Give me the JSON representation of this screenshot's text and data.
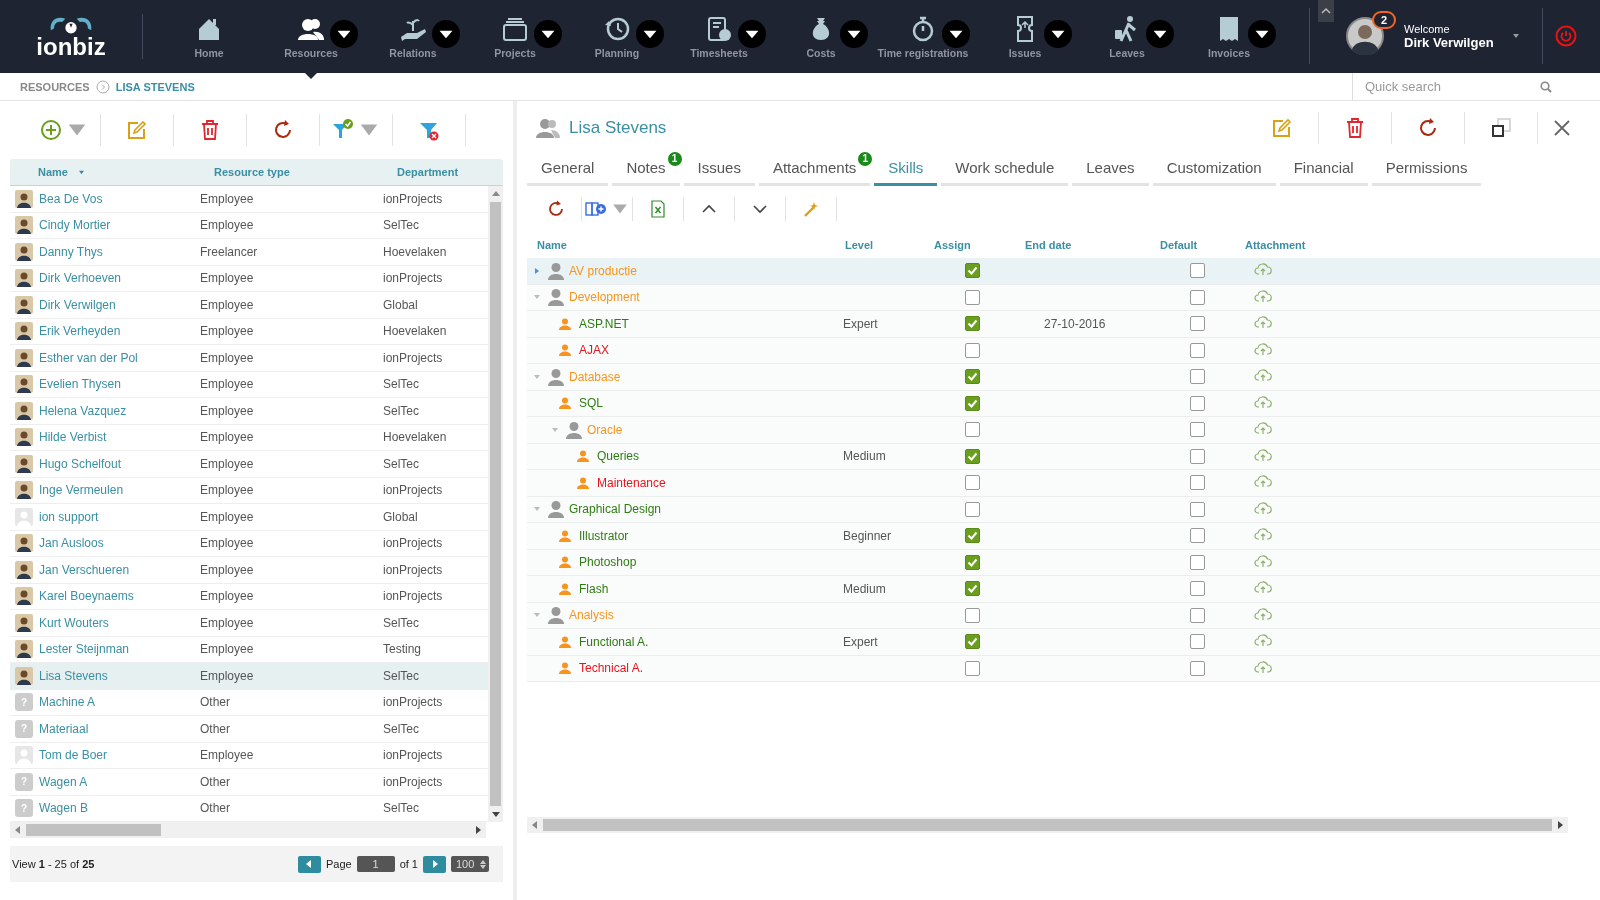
{
  "brand": "ionbiz",
  "nav": [
    {
      "label": "Home",
      "menu": false,
      "selected": false
    },
    {
      "label": "Resources",
      "menu": true,
      "selected": true
    },
    {
      "label": "Relations",
      "menu": true,
      "selected": false
    },
    {
      "label": "Projects",
      "menu": true,
      "selected": false
    },
    {
      "label": "Planning",
      "menu": true,
      "selected": false
    },
    {
      "label": "Timesheets",
      "menu": true,
      "selected": false
    },
    {
      "label": "Costs",
      "menu": true,
      "selected": false
    },
    {
      "label": "Time registrations",
      "menu": true,
      "selected": false
    },
    {
      "label": "Issues",
      "menu": true,
      "selected": false
    },
    {
      "label": "Leaves",
      "menu": true,
      "selected": false
    },
    {
      "label": "Invoices",
      "menu": true,
      "selected": false
    }
  ],
  "user": {
    "greeting": "Welcome",
    "name": "Dirk Verwilgen",
    "notifications": "2"
  },
  "breadcrumb": [
    "RESOURCES",
    "LISA STEVENS"
  ],
  "search": {
    "placeholder": "Quick search"
  },
  "resources": {
    "columns": [
      "Name",
      "Resource type",
      "Department"
    ],
    "rows": [
      {
        "name": "Bea De Vos",
        "type": "Employee",
        "department": "ionProjects",
        "kind": "photo",
        "selected": false
      },
      {
        "name": "Cindy Mortier",
        "type": "Employee",
        "department": "SelTec",
        "kind": "photo",
        "selected": false
      },
      {
        "name": "Danny Thys",
        "type": "Freelancer",
        "department": "Hoevelaken",
        "kind": "photo",
        "selected": false
      },
      {
        "name": "Dirk Verhoeven",
        "type": "Employee",
        "department": "ionProjects",
        "kind": "photo",
        "selected": false
      },
      {
        "name": "Dirk Verwilgen",
        "type": "Employee",
        "department": "Global",
        "kind": "photo",
        "selected": false
      },
      {
        "name": "Erik Verheyden",
        "type": "Employee",
        "department": "Hoevelaken",
        "kind": "photo",
        "selected": false
      },
      {
        "name": "Esther van der Pol",
        "type": "Employee",
        "department": "ionProjects",
        "kind": "photo",
        "selected": false
      },
      {
        "name": "Evelien Thysen",
        "type": "Employee",
        "department": "SelTec",
        "kind": "photo",
        "selected": false
      },
      {
        "name": "Helena Vazquez",
        "type": "Employee",
        "department": "SelTec",
        "kind": "photo",
        "selected": false
      },
      {
        "name": "Hilde Verbist",
        "type": "Employee",
        "department": "Hoevelaken",
        "kind": "photo",
        "selected": false
      },
      {
        "name": "Hugo Schelfout",
        "type": "Employee",
        "department": "SelTec",
        "kind": "photo",
        "selected": false
      },
      {
        "name": "Inge Vermeulen",
        "type": "Employee",
        "department": "ionProjects",
        "kind": "photo",
        "selected": false
      },
      {
        "name": "ion support",
        "type": "Employee",
        "department": "Global",
        "kind": "silhouette",
        "selected": false
      },
      {
        "name": "Jan Ausloos",
        "type": "Employee",
        "department": "ionProjects",
        "kind": "photo",
        "selected": false
      },
      {
        "name": "Jan Verschueren",
        "type": "Employee",
        "department": "ionProjects",
        "kind": "photo",
        "selected": false
      },
      {
        "name": "Karel Boeynaems",
        "type": "Employee",
        "department": "ionProjects",
        "kind": "photo",
        "selected": false
      },
      {
        "name": "Kurt Wouters",
        "type": "Employee",
        "department": "SelTec",
        "kind": "photo",
        "selected": false
      },
      {
        "name": "Lester Steijnman",
        "type": "Employee",
        "department": "Testing",
        "kind": "photo",
        "selected": false
      },
      {
        "name": "Lisa Stevens",
        "type": "Employee",
        "department": "SelTec",
        "kind": "photo",
        "selected": true
      },
      {
        "name": "Machine A",
        "type": "Other",
        "department": "ionProjects",
        "kind": "unknown",
        "avatar_text": "?",
        "selected": false
      },
      {
        "name": "Materiaal",
        "type": "Other",
        "department": "SelTec",
        "kind": "unknown",
        "avatar_text": "?",
        "selected": false
      },
      {
        "name": "Tom de Boer",
        "type": "Employee",
        "department": "ionProjects",
        "kind": "silhouette",
        "selected": false
      },
      {
        "name": "Wagen A",
        "type": "Other",
        "department": "ionProjects",
        "kind": "unknown",
        "avatar_text": "?",
        "selected": false
      },
      {
        "name": "Wagen B",
        "type": "Other",
        "department": "SelTec",
        "kind": "unknown",
        "avatar_text": "?",
        "selected": false
      }
    ],
    "pager": {
      "summary": "View **1** - 25 of **25**",
      "page_label": "Page",
      "page": "1",
      "of": "of 1",
      "page_size": "100"
    }
  },
  "detail": {
    "title": "Lisa Stevens",
    "tabs": [
      {
        "label": "General",
        "selected": false
      },
      {
        "label": "Notes",
        "badge": "1",
        "selected": false
      },
      {
        "label": "Issues",
        "selected": false
      },
      {
        "label": "Attachments",
        "badge": "1",
        "selected": false
      },
      {
        "label": "Skills",
        "selected": true
      },
      {
        "label": "Work schedule",
        "selected": false
      },
      {
        "label": "Leaves",
        "selected": false
      },
      {
        "label": "Customization",
        "selected": false
      },
      {
        "label": "Financial",
        "selected": false
      },
      {
        "label": "Permissions",
        "selected": false
      }
    ],
    "skills": {
      "columns": [
        "Name",
        "Level",
        "Assign",
        "End date",
        "Default",
        "Attachment"
      ],
      "rows": [
        {
          "kind": "category",
          "name": "AV productie",
          "color": "#f7941d",
          "assign": true,
          "default": false,
          "expanded": false,
          "selected": true
        },
        {
          "kind": "category",
          "name": "Development",
          "color": "#f7941d",
          "assign": false,
          "default": false,
          "expanded": true,
          "selected": false,
          "children": [
            {
              "kind": "skill",
              "name": "ASP.NET",
              "color": "#2e7d12",
              "level": "Expert",
              "assign": true,
              "end_date": "27-10-2016",
              "default": false,
              "selected": false
            },
            {
              "kind": "skill",
              "name": "AJAX",
              "color": "#e8141b",
              "assign": false,
              "default": false,
              "selected": false
            }
          ]
        },
        {
          "kind": "category",
          "name": "Database",
          "color": "#f7941d",
          "assign": true,
          "default": false,
          "expanded": true,
          "selected": false,
          "children": [
            {
              "kind": "skill",
              "name": "SQL",
              "color": "#2e7d12",
              "assign": true,
              "default": false,
              "selected": false
            },
            {
              "kind": "category",
              "name": "Oracle",
              "color": "#f7941d",
              "assign": false,
              "default": false,
              "expanded": true,
              "selected": false,
              "children": [
                {
                  "kind": "skill",
                  "name": "Queries",
                  "color": "#2e7d12",
                  "level": "Medium",
                  "assign": true,
                  "default": false,
                  "selected": false
                },
                {
                  "kind": "skill",
                  "name": "Maintenance",
                  "color": "#e8141b",
                  "assign": false,
                  "default": false,
                  "selected": false
                }
              ]
            }
          ]
        },
        {
          "kind": "category",
          "name": "Graphical Design",
          "color": "#2e7d12",
          "assign": false,
          "default": false,
          "expanded": true,
          "selected": false,
          "children": [
            {
              "kind": "skill",
              "name": "Illustrator",
              "color": "#2e7d12",
              "level": "Beginner",
              "assign": true,
              "default": false,
              "selected": false
            },
            {
              "kind": "skill",
              "name": "Photoshop",
              "color": "#2e7d12",
              "assign": true,
              "default": false,
              "selected": false
            },
            {
              "kind": "skill",
              "name": "Flash",
              "color": "#2e7d12",
              "level": "Medium",
              "assign": true,
              "default": false,
              "selected": false
            }
          ]
        },
        {
          "kind": "category",
          "name": "Analysis",
          "color": "#f7941d",
          "assign": false,
          "default": false,
          "expanded": true,
          "selected": false,
          "children": [
            {
              "kind": "skill",
              "name": "Functional A.",
              "color": "#2e7d12",
              "level": "Expert",
              "assign": true,
              "default": false,
              "selected": false
            },
            {
              "kind": "skill",
              "name": "Technical A.",
              "color": "#e8141b",
              "assign": false,
              "default": false,
              "selected": false
            }
          ]
        }
      ]
    }
  }
}
